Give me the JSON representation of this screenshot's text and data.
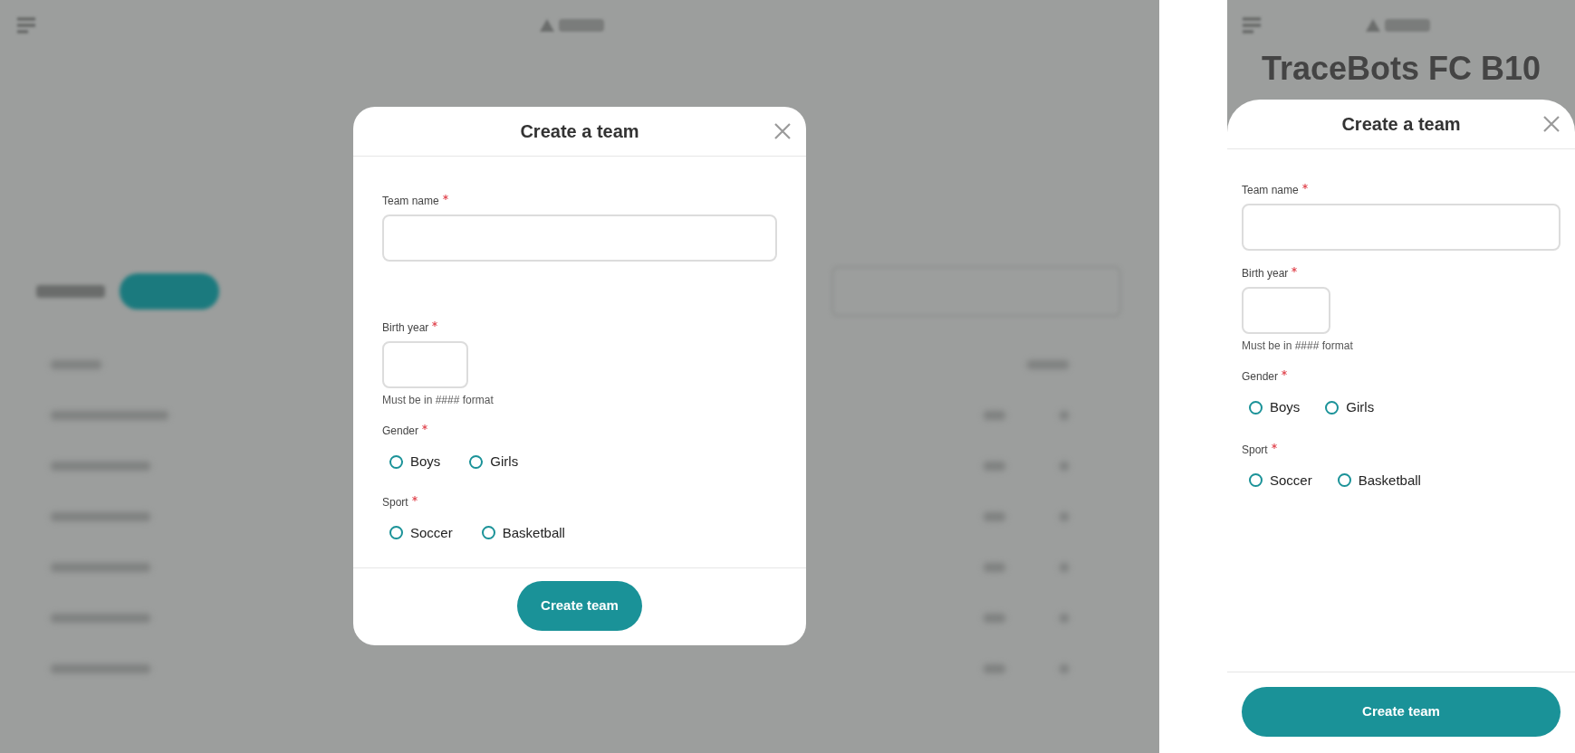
{
  "desktop": {
    "modal": {
      "title": "Create a team",
      "fields": [
        {
          "kind": "text",
          "label": "Team name",
          "required": true
        },
        {
          "kind": "year",
          "label": "Birth year",
          "required": true,
          "hint": "Must be in #### format"
        },
        {
          "kind": "radio",
          "label": "Gender",
          "required": true,
          "options": [
            {
              "label": "Boys",
              "selected": false
            },
            {
              "label": "Girls",
              "selected": false
            }
          ]
        },
        {
          "kind": "radio",
          "label": "Sport",
          "required": true,
          "options": [
            {
              "label": "Soccer",
              "selected": false
            },
            {
              "label": "Basketball",
              "selected": false
            }
          ]
        }
      ],
      "submit": "Create team"
    }
  },
  "mobile": {
    "background": {
      "club_title": "TraceBots FC B10"
    },
    "modal": {
      "title": "Create a team",
      "fields": [
        {
          "kind": "text",
          "label": "Team name",
          "required": true
        },
        {
          "kind": "year",
          "label": "Birth year",
          "required": true,
          "hint": "Must be in #### format"
        },
        {
          "kind": "radio",
          "label": "Gender",
          "required": true,
          "options": [
            {
              "label": "Boys",
              "selected": false
            },
            {
              "label": "Girls",
              "selected": false
            }
          ]
        },
        {
          "kind": "radio",
          "label": "Sport",
          "required": true,
          "options": [
            {
              "label": "Soccer",
              "selected": false
            },
            {
              "label": "Basketball",
              "selected": false
            }
          ]
        }
      ],
      "submit": "Create team"
    }
  }
}
